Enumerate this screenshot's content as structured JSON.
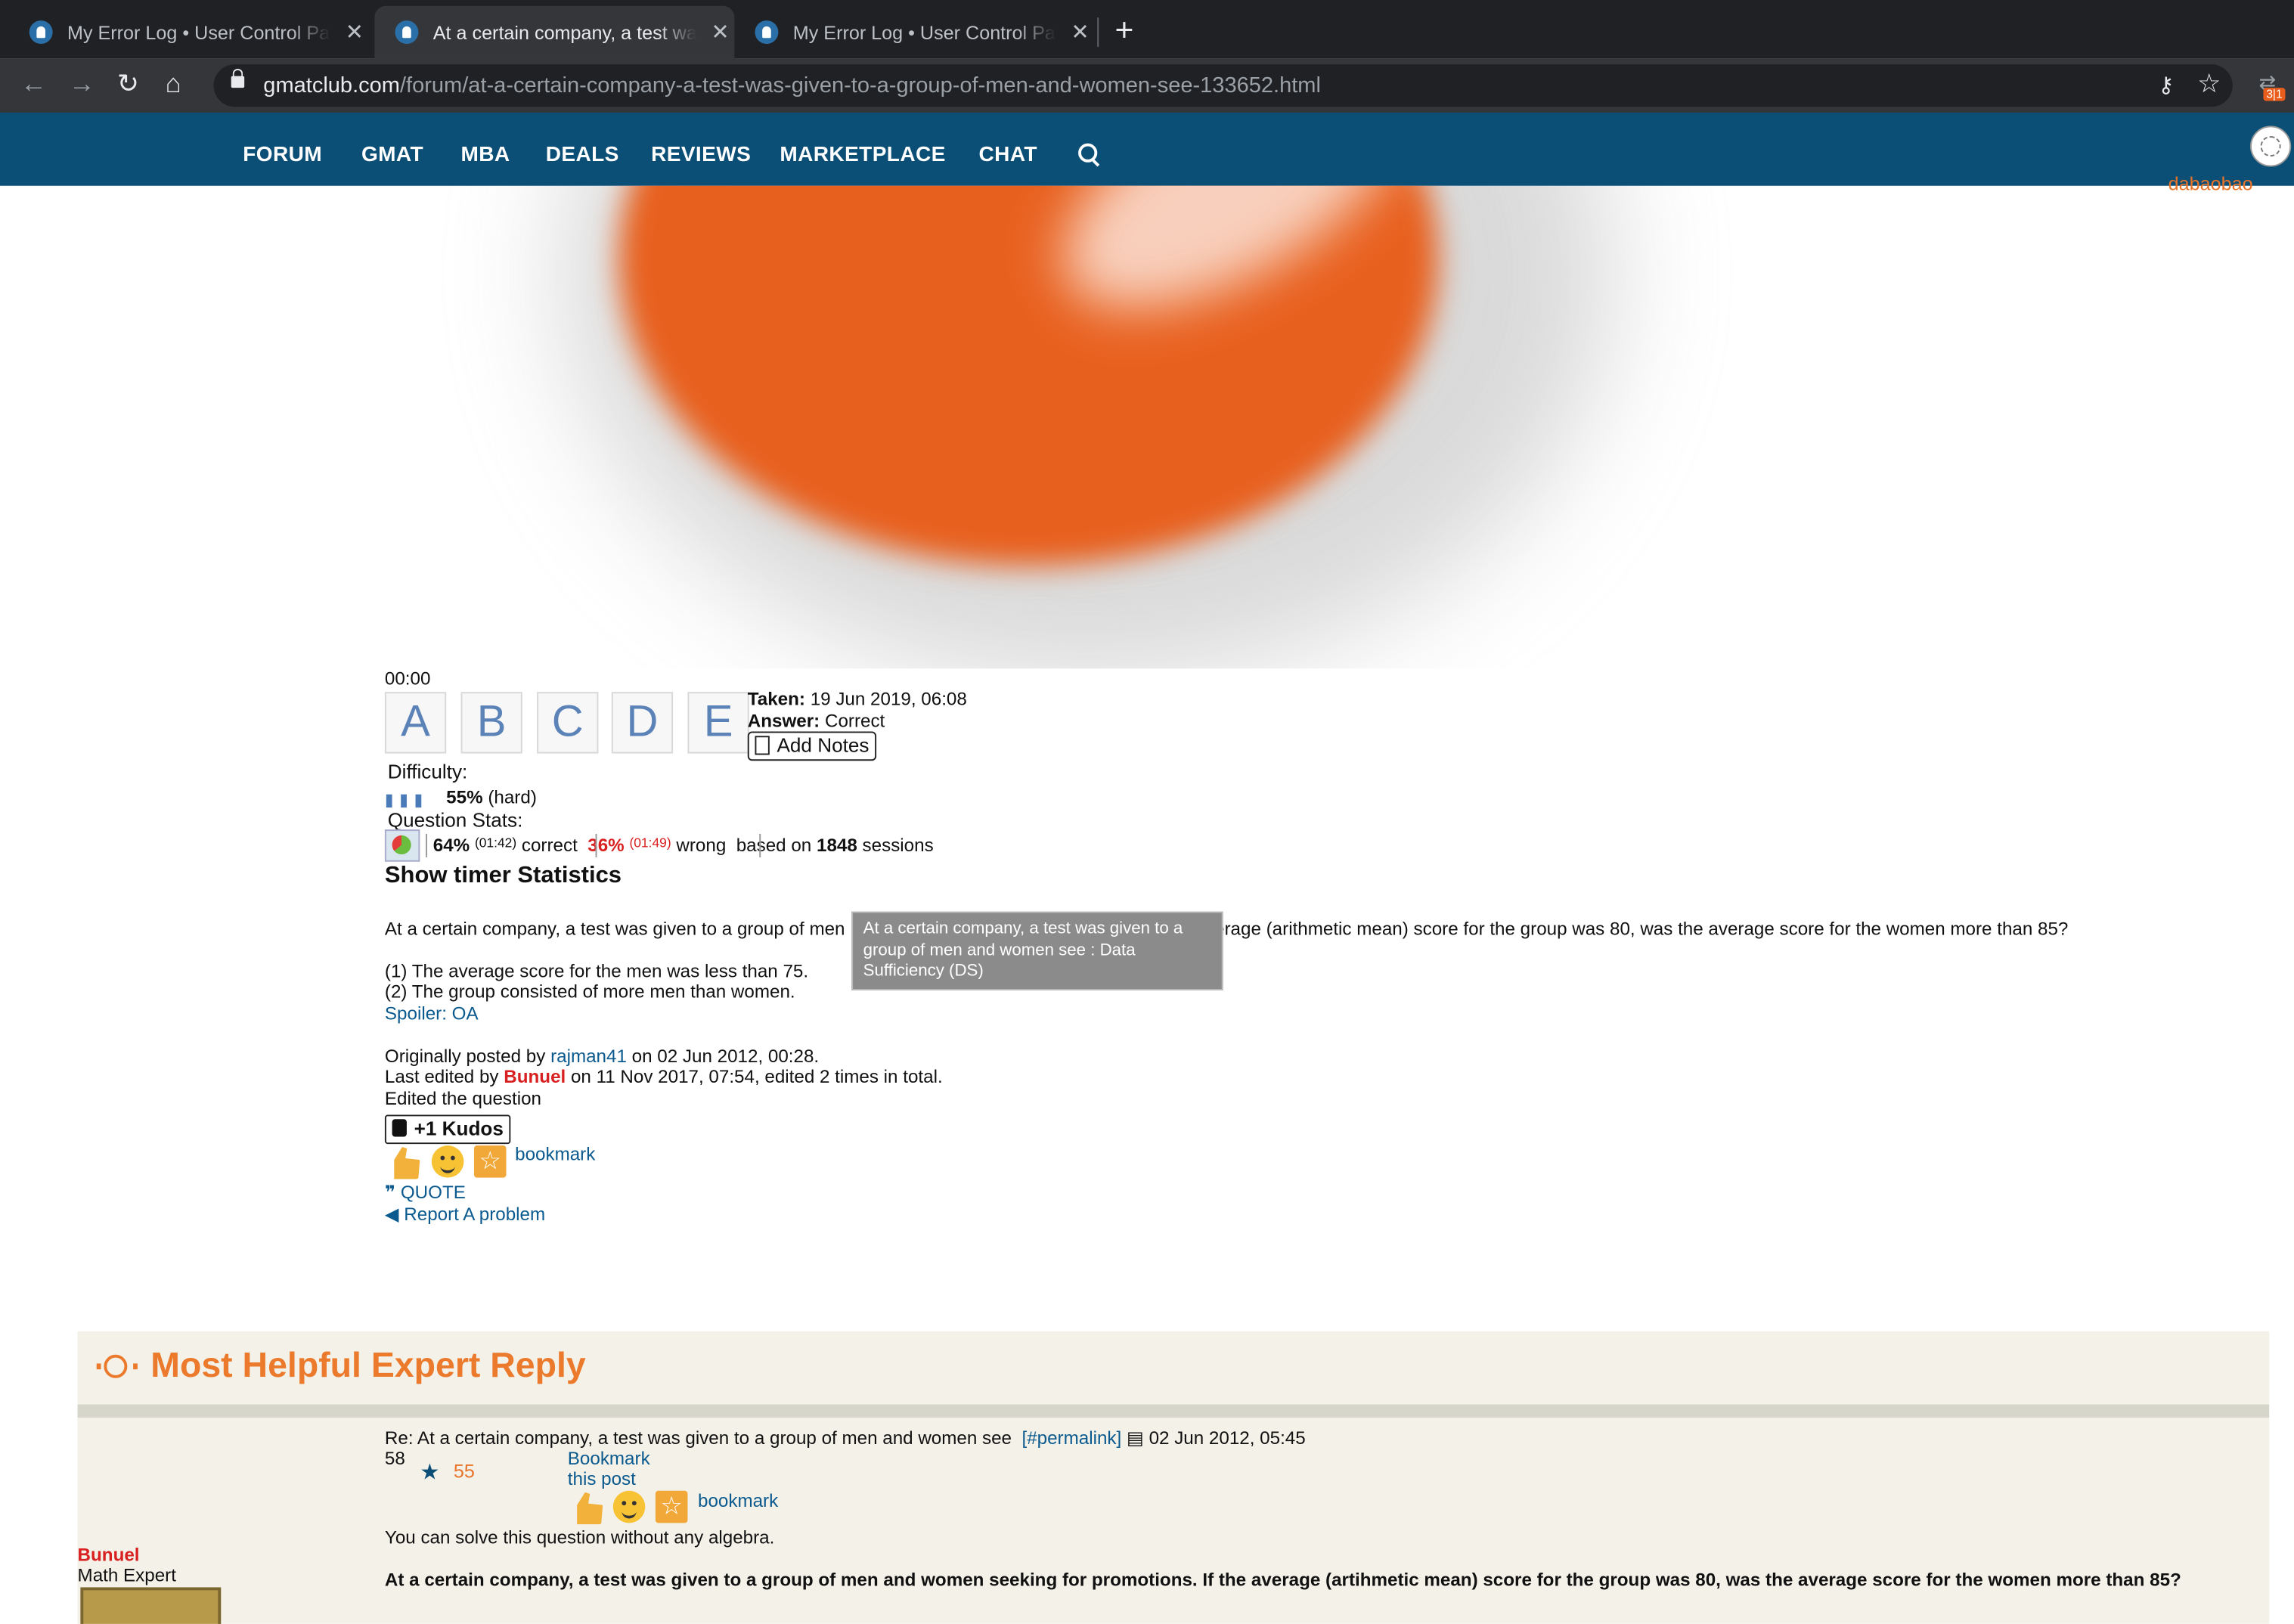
{
  "browser": {
    "tabs": [
      {
        "title": "My Error Log • User Control Panel"
      },
      {
        "title": "At a certain company, a test was given to a group of men and women see"
      },
      {
        "title": "My Error Log • User Control Panel"
      }
    ],
    "url_domain": "gmatclub.com",
    "url_path": "/forum/at-a-certain-company-a-test-was-given-to-a-group-of-men-and-women-see-133652.html",
    "extension_badge": "3|1"
  },
  "site_nav": {
    "items": [
      "FORUM",
      "GMAT",
      "MBA",
      "DEALS",
      "REVIEWS",
      "MARKETPLACE",
      "CHAT"
    ],
    "username": "dabaobao"
  },
  "question": {
    "timer": "00:00",
    "choices": [
      "A",
      "B",
      "C",
      "D",
      "E"
    ],
    "taken_label": "Taken:",
    "taken_value": "19 Jun 2019, 06:08",
    "answer_label": "Answer:",
    "answer_value": "Correct",
    "add_notes": "Add Notes",
    "difficulty_label": "Difficulty:",
    "difficulty_pct": "55%",
    "difficulty_level": "(hard)",
    "stats_label": "Question Stats:",
    "correct_pct": "64%",
    "correct_time": "(01:42)",
    "correct_word": "correct",
    "wrong_pct": "36%",
    "wrong_time": "(01:49)",
    "wrong_word": "wrong",
    "based_on": "based on",
    "sessions_count": "1848",
    "sessions_word": "sessions",
    "show_timer": "Show timer Statistics",
    "text_start": "At a certain company, a test was given to a group of men",
    "text_end": "erage (arithmetic mean) score for the group was 80, was the average score for the women more than 85?",
    "statement1": "(1) The average score for the men was less than 75.",
    "statement2": "(2) The group consisted of more men than women.",
    "spoiler": "Spoiler: OA",
    "orig_prefix": "Originally posted by",
    "orig_user": "rajman41",
    "orig_suffix": "on 02 Jun 2012, 00:28.",
    "edit_prefix": "Last edited by",
    "edit_user": "Bunuel",
    "edit_suffix": "on 11 Nov 2017, 07:54, edited 2 times in total.",
    "edit_reason": "Edited the question",
    "kudos": "+1 Kudos",
    "bookmark": "bookmark",
    "quote": "QUOTE",
    "report": "Report A problem",
    "tooltip": "At a certain company, a test was given to a group of men and women see : Data Sufficiency (DS)"
  },
  "expert_reply": {
    "title": "Most Helpful Expert Reply",
    "re_title": "Re: At a certain company, a test was given to a group of men and women see",
    "permalink": "[#permalink]",
    "date": "02 Jun 2012, 05:45",
    "kudos_count": "58",
    "star_count": "55",
    "bookmark_post_1": "Bookmark",
    "bookmark_post_2": "this post",
    "bookmark": "bookmark",
    "solve_text": "You can solve this question without any algebra.",
    "bold_question": "At a certain company, a test was given to a group of men and women seeking for promotions. If the average (artihmetic mean) score for the group was 80, was the average score for the women more than 85?",
    "author": "Bunuel",
    "author_role": "Math Expert"
  },
  "colors": {
    "nav_bg": "#0b4f77",
    "accent_orange": "#ec7a2c",
    "link_blue": "#0b5a8f",
    "wrong_red": "#d92020"
  }
}
